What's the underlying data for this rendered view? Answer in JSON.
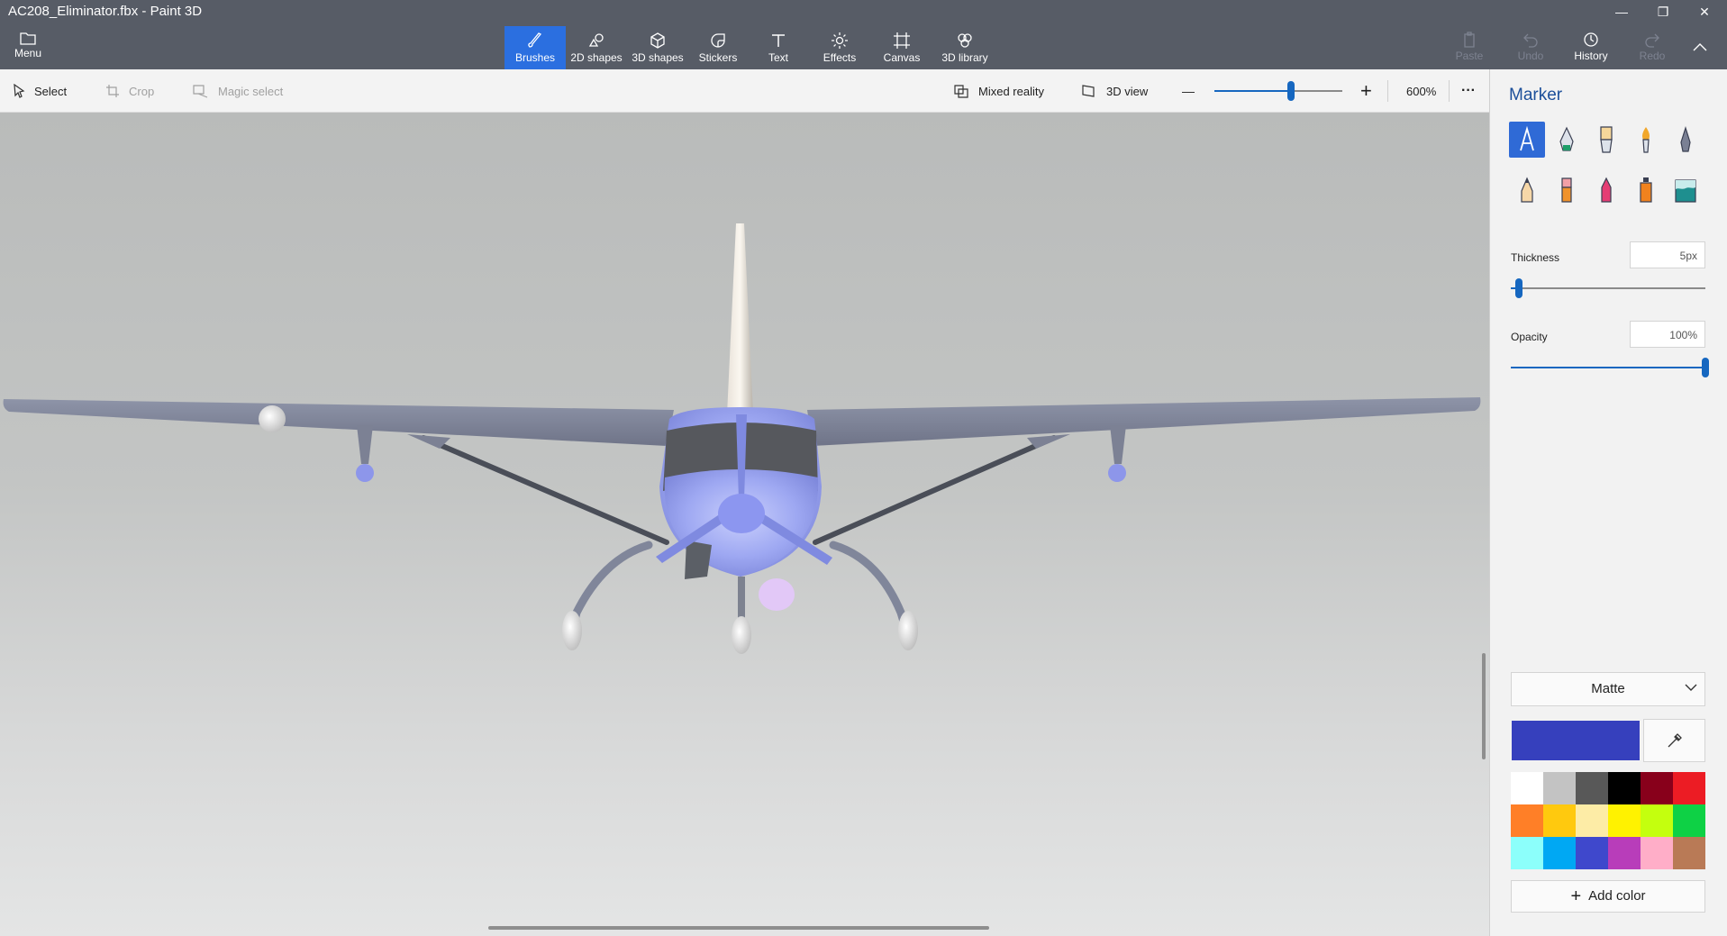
{
  "window": {
    "title": "AC208_Eliminator.fbx - Paint 3D",
    "minimize_glyph": "—",
    "restore_glyph": "❐",
    "close_glyph": "✕"
  },
  "ribbon": {
    "menu_label": "Menu",
    "tabs": [
      {
        "label": "Brushes",
        "icon": "brush-icon",
        "active": true
      },
      {
        "label": "2D shapes",
        "icon": "2d-shapes-icon",
        "active": false
      },
      {
        "label": "3D shapes",
        "icon": "3d-shapes-icon",
        "active": false
      },
      {
        "label": "Stickers",
        "icon": "sticker-icon",
        "active": false
      },
      {
        "label": "Text",
        "icon": "text-icon",
        "active": false
      },
      {
        "label": "Effects",
        "icon": "effects-icon",
        "active": false
      },
      {
        "label": "Canvas",
        "icon": "canvas-icon",
        "active": false
      },
      {
        "label": "3D library",
        "icon": "3d-library-icon",
        "active": false
      }
    ],
    "right_tools": [
      {
        "label": "Paste",
        "icon": "paste-icon",
        "enabled": false
      },
      {
        "label": "Undo",
        "icon": "undo-icon",
        "enabled": false
      },
      {
        "label": "History",
        "icon": "history-icon",
        "enabled": true
      },
      {
        "label": "Redo",
        "icon": "redo-icon",
        "enabled": false
      }
    ],
    "collapse_icon": "chevron-up-icon",
    "accent_color": "#2b6fe0",
    "background_color": "#575c66"
  },
  "toolbar": {
    "select_label": "Select",
    "crop_label": "Crop",
    "magic_select_label": "Magic select",
    "mixed_reality_label": "Mixed reality",
    "view_3d_label": "3D view",
    "zoom_out_glyph": "—",
    "zoom_in_glyph": "+",
    "zoom_level": "600%",
    "zoom_slider_fraction": 0.6,
    "more_glyph": "···"
  },
  "panel": {
    "title": "Marker",
    "brushes": [
      {
        "name": "marker",
        "selected": true
      },
      {
        "name": "calligraphy-pen",
        "selected": false
      },
      {
        "name": "oil-brush",
        "selected": false
      },
      {
        "name": "watercolor",
        "selected": false
      },
      {
        "name": "pixel-pen",
        "selected": false
      },
      {
        "name": "pencil",
        "selected": false
      },
      {
        "name": "eraser",
        "selected": false
      },
      {
        "name": "crayon",
        "selected": false
      },
      {
        "name": "spray-can",
        "selected": false
      },
      {
        "name": "fill",
        "selected": false
      }
    ],
    "thickness_label": "Thickness",
    "thickness_value": "5px",
    "thickness_fraction": 0.04,
    "opacity_label": "Opacity",
    "opacity_value": "100%",
    "opacity_fraction": 1.0,
    "finish": "Matte",
    "current_color": "#3640bd",
    "palette": [
      "#ffffff",
      "#c3c3c3",
      "#585858",
      "#000000",
      "#88001b",
      "#ec1c24",
      "#ff7f27",
      "#ffc90e",
      "#fdeca6",
      "#fff200",
      "#c4ff0e",
      "#0ed145",
      "#8cfffb",
      "#00a8f3",
      "#3f48cc",
      "#b83dba",
      "#ffaec8",
      "#b97a56"
    ],
    "add_color_label": "Add color"
  }
}
